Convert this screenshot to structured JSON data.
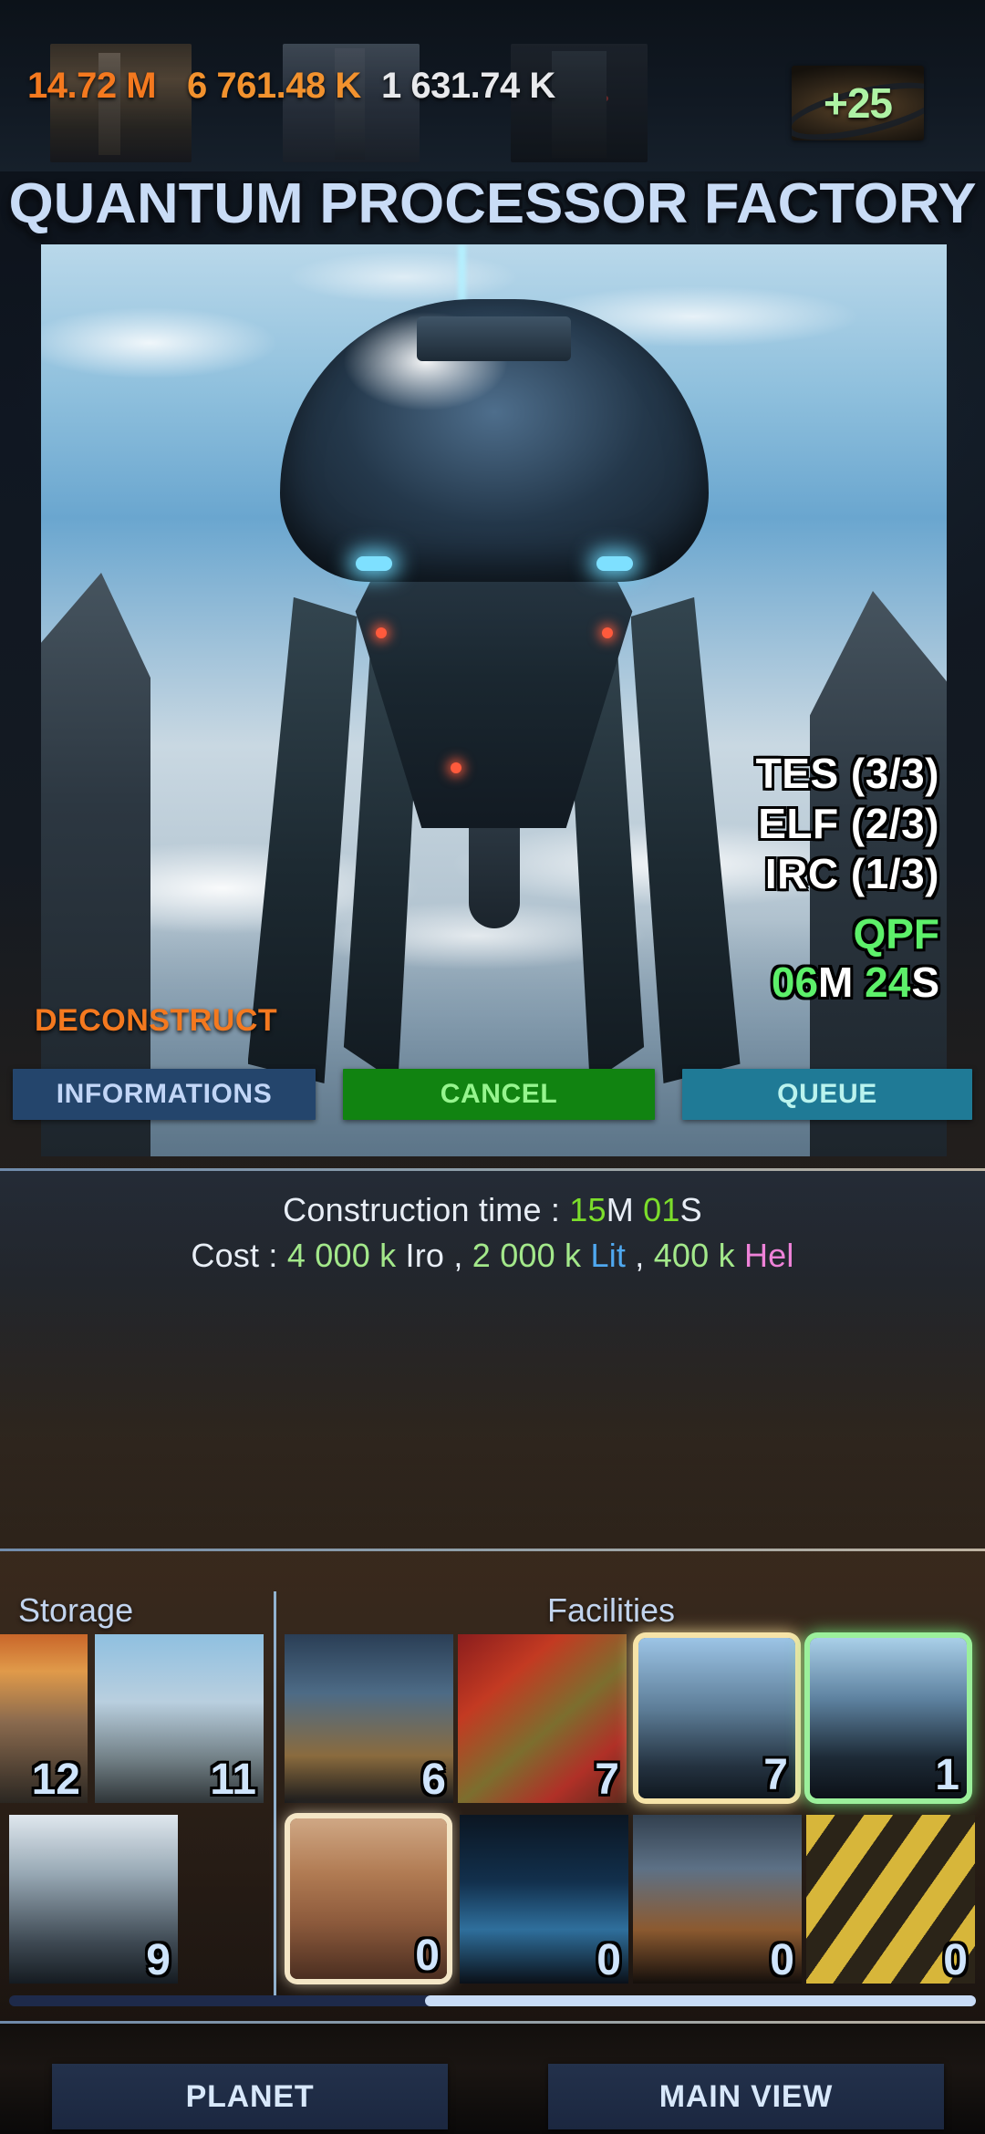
{
  "topbar": {
    "resources": [
      {
        "name": "iron",
        "value": "14.72 M",
        "color": "#F4791F"
      },
      {
        "name": "lithium",
        "value": "6 761.48 K",
        "color": "#F2922E"
      },
      {
        "name": "helium",
        "value": "1 631.74 K",
        "color": "#E8E9EC"
      }
    ],
    "badge": {
      "value": "+25",
      "color": "#AEF2A4"
    }
  },
  "header": {
    "title": "QUANTUM PROCESSOR FACTORY",
    "title_color": "#C9DCF6"
  },
  "hero": {
    "requirements": [
      "TES (3/3)",
      "ELF (2/3)",
      "IRC (1/3)"
    ],
    "building_code": "QPF",
    "timer": {
      "minutes": "06",
      "minutes_unit": "M",
      "seconds": "24",
      "seconds_unit": "S"
    },
    "deconstruct_label": "DECONSTRUCT"
  },
  "actions": {
    "informations": "INFORMATIONS",
    "cancel": "CANCEL",
    "queue": "QUEUE"
  },
  "info": {
    "construction_label": "Construction time : ",
    "construction_minutes": "15",
    "construction_minutes_unit": "M",
    "construction_seconds": "01",
    "construction_seconds_unit": "S",
    "cost_label": "Cost : ",
    "cost_items": [
      {
        "amount": "4 000 k",
        "resource": "Iro",
        "resource_color": "#E8EEF6"
      },
      {
        "amount": "2 000 k",
        "resource": "Lit",
        "resource_color": "#4FA8F0"
      },
      {
        "amount": "400 k",
        "resource": "Hel",
        "resource_color": "#EE82D8"
      }
    ],
    "separator": " , "
  },
  "tiles": {
    "storage_label": "Storage",
    "facilities_label": "Facilities",
    "storage": [
      {
        "count": "12",
        "art": "art-a",
        "glow": ""
      },
      {
        "count": "11",
        "art": "art-b",
        "glow": ""
      },
      {
        "count": "9",
        "art": "art-g",
        "glow": ""
      }
    ],
    "facilities": [
      {
        "count": "6",
        "art": "art-c",
        "glow": ""
      },
      {
        "count": "7",
        "art": "art-d",
        "glow": ""
      },
      {
        "count": "7",
        "art": "art-e",
        "glow": "glow-gold"
      },
      {
        "count": "1",
        "art": "art-f",
        "glow": "glow-green"
      },
      {
        "count": "0",
        "art": "art-h",
        "glow": "glow-cream"
      },
      {
        "count": "0",
        "art": "art-i",
        "glow": ""
      },
      {
        "count": "0",
        "art": "art-j",
        "glow": ""
      },
      {
        "count": "0",
        "art": "art-k",
        "glow": ""
      }
    ]
  },
  "bottom_nav": {
    "planet": "PLANET",
    "main_view": "MAIN VIEW"
  }
}
